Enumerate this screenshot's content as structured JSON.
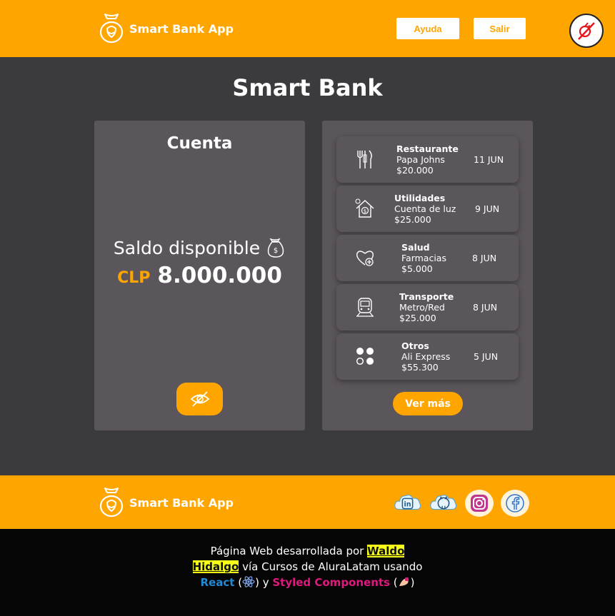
{
  "header": {
    "brand": "Smart Bank App",
    "help_label": "Ayuda",
    "exit_label": "Salir",
    "toggle_icon": "no-mode-icon"
  },
  "main": {
    "title": "Smart Bank"
  },
  "account": {
    "title": "Cuenta",
    "balance_label": "Saldo disponible",
    "currency": "CLP",
    "amount": "8.000.000",
    "visibility_icon": "eye-slash-icon"
  },
  "transactions": {
    "items": [
      {
        "category": "Restaurante",
        "merchant": "Papa Johns",
        "amount": "$20.000",
        "date": "11 JUN",
        "icon": "cutlery-icon"
      },
      {
        "category": "Utilidades",
        "merchant": "Cuenta de luz",
        "amount": "$25.000",
        "date": "9 JUN",
        "icon": "house-bill-icon"
      },
      {
        "category": "Salud",
        "merchant": "Farmacias",
        "amount": "$5.000",
        "date": "8 JUN",
        "icon": "health-heart-icon"
      },
      {
        "category": "Transporte",
        "merchant": "Metro/Red",
        "amount": "$25.000",
        "date": "8 JUN",
        "icon": "train-icon"
      },
      {
        "category": "Otros",
        "merchant": "Ali Express",
        "amount": "$55.300",
        "date": "5 JUN",
        "icon": "dots-icon"
      }
    ],
    "more_label": "Ver más"
  },
  "footer": {
    "brand": "Smart Bank App",
    "socials": [
      "linkedin-icon",
      "github-icon",
      "instagram-icon",
      "facebook-icon"
    ]
  },
  "credits": {
    "text1": "Página Web desarrollada por ",
    "author1": "Waldo",
    "author2": "Hidalgo",
    "text2": " vía Cursos de AluraLatam usando",
    "react": "React",
    "and": " y ",
    "styled": "Styled Components"
  },
  "colors": {
    "accent": "#ffa500",
    "background": "#3b3b3d",
    "card": "#5b565b",
    "footer_bottom": "#050505"
  }
}
